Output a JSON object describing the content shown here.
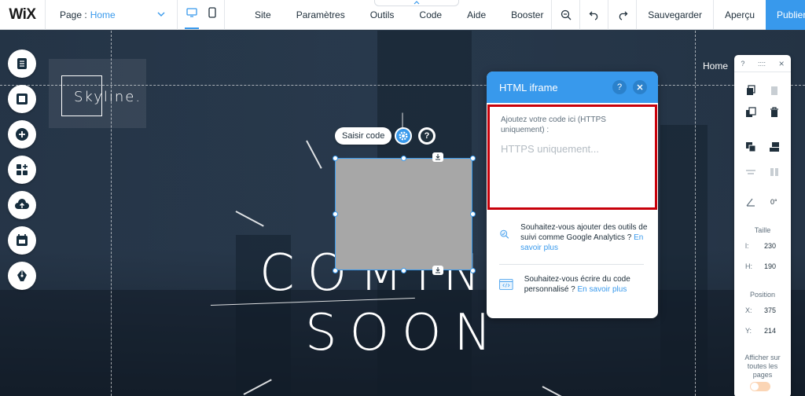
{
  "topbar": {
    "logo": "WiX",
    "page_label": "Page :",
    "page_value": "Home",
    "menu": [
      "Site",
      "Paramètres",
      "Outils",
      "Code",
      "Aide",
      "Booster"
    ],
    "save": "Sauvegarder",
    "preview": "Aperçu",
    "publish": "Publier"
  },
  "canvas": {
    "logo_text": "Skyline.",
    "nav_home": "Home",
    "headline_1": "COMIN",
    "headline_2": "SOON"
  },
  "element": {
    "edit_code": "Saisir code"
  },
  "panel": {
    "title": "HTML iframe",
    "code_label": "Ajoutez votre code ici (HTTPS uniquement) :",
    "code_placeholder": "HTTPS uniquement...",
    "tip1_text": "Souhaitez-vous ajouter des outils de suivi comme Google Analytics ?",
    "tip1_link": "En savoir plus",
    "tip2_text": "Souhaitez-vous écrire du code personnalisé ?",
    "tip2_link": "En savoir plus"
  },
  "right_panel": {
    "help": "?",
    "close": "×",
    "rotation": "0°",
    "size_label": "Taille",
    "width_key": "l:",
    "width_val": "230",
    "height_key": "H:",
    "height_val": "190",
    "pos_label": "Position",
    "x_key": "X:",
    "x_val": "375",
    "y_key": "Y:",
    "y_val": "214",
    "show_all": "Afficher sur toutes les pages"
  },
  "colors": {
    "accent": "#3899ec",
    "highlight": "#c8000a"
  }
}
